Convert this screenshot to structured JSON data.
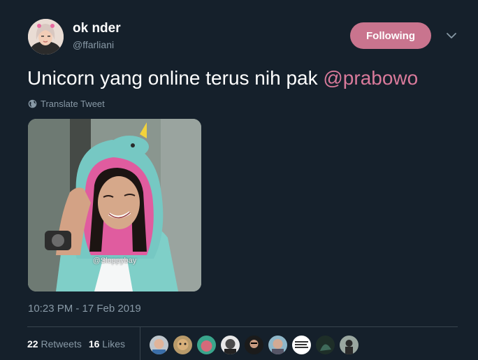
{
  "author": {
    "name": "ok nder",
    "handle": "@ffarliani"
  },
  "follow_button": {
    "label": "Following"
  },
  "tweet": {
    "text": "Unicorn yang online terus nih pak ",
    "mention": "@prabowo",
    "translate_label": "Translate Tweet",
    "media_watermark": "@Sloppybay",
    "timestamp": "10:23 PM - 17 Feb 2019"
  },
  "stats": {
    "retweets_count": "22",
    "retweets_label": "Retweets",
    "likes_count": "16",
    "likes_label": "Likes"
  },
  "likers": [
    "avatar",
    "avatar",
    "avatar",
    "avatar",
    "avatar",
    "avatar",
    "avatar",
    "avatar",
    "avatar"
  ],
  "colors": {
    "background": "#15202b",
    "follow_button": "#c9748e",
    "mention": "#d97a9b",
    "secondary_text": "#8899a6"
  }
}
